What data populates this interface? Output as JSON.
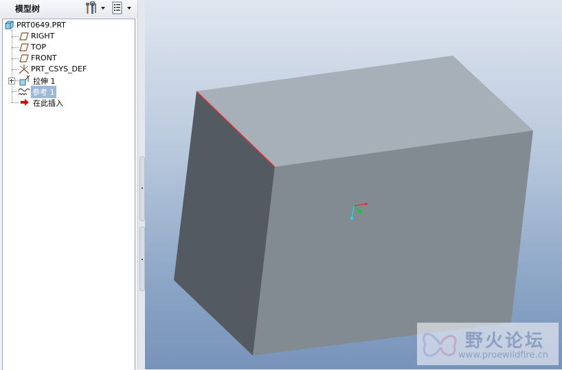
{
  "panel": {
    "title": "模型树",
    "settings_button_icon": "wrench-hammer-icon",
    "show_button_icon": "list-icon"
  },
  "tree": {
    "root": {
      "label": "PRT0649.PRT",
      "icon": "part-icon"
    },
    "items": [
      {
        "label": "RIGHT",
        "icon": "datum-plane-icon"
      },
      {
        "label": "TOP",
        "icon": "datum-plane-icon"
      },
      {
        "label": "FRONT",
        "icon": "datum-plane-icon"
      },
      {
        "label": "PRT_CSYS_DEF",
        "icon": "coordinate-system-icon"
      },
      {
        "label": "拉伸 1",
        "icon": "extrude-icon",
        "expandable": true
      },
      {
        "label": "参考 1",
        "icon": "reference-curve-icon",
        "selected": true
      },
      {
        "label": "在此插入",
        "icon": "insert-here-arrow-icon"
      }
    ]
  },
  "colors": {
    "selection_bg": "#9db8d8",
    "top_face": "#a7b0b8",
    "front_face": "#838b92",
    "side_face": "#545a61",
    "highlight_edge": "#ff2a2a",
    "insert_arrow": "#d01010"
  },
  "watermark": {
    "title": "野火论坛",
    "url": "www.proewildfire.cn"
  }
}
